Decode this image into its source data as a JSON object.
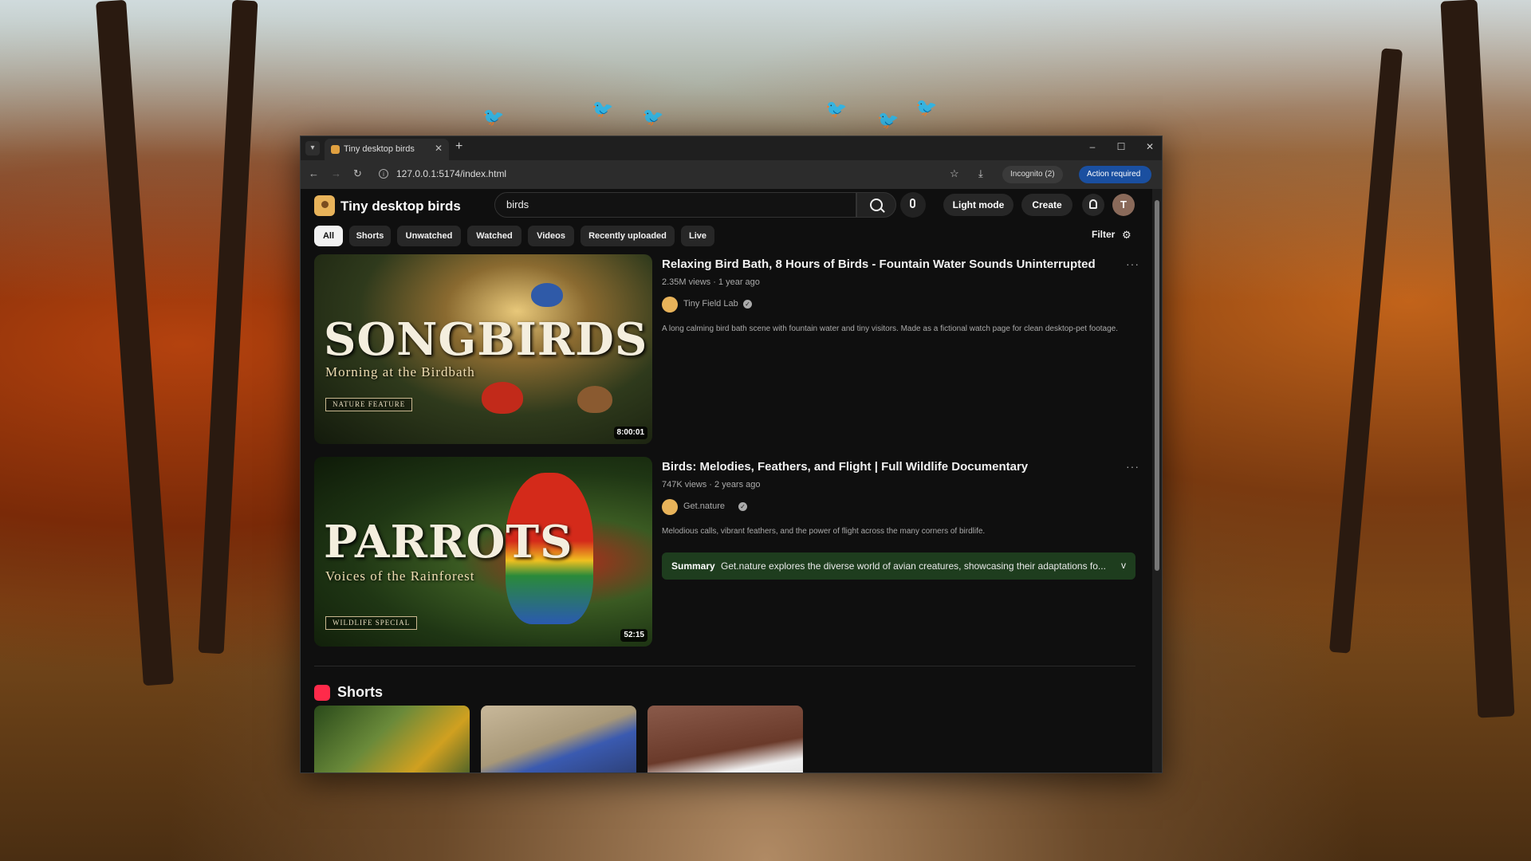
{
  "browser": {
    "tab_title": "Tiny desktop birds",
    "url": "127.0.0.1:5174/index.html",
    "incognito_label": "Incognito (2)",
    "action_label": "Action required"
  },
  "header": {
    "site_title": "Tiny desktop birds",
    "search_value": "birds",
    "light_mode_label": "Light mode",
    "create_label": "Create",
    "avatar_initial": "T"
  },
  "chips": [
    {
      "label": "All",
      "active": true
    },
    {
      "label": "Shorts"
    },
    {
      "label": "Unwatched"
    },
    {
      "label": "Watched"
    },
    {
      "label": "Videos"
    },
    {
      "label": "Recently uploaded"
    },
    {
      "label": "Live"
    }
  ],
  "filter_label": "Filter",
  "results": [
    {
      "title": "Relaxing Bird Bath, 8 Hours of Birds - Fountain Water Sounds Uninterrupted",
      "meta": "2.35M views · 1 year ago",
      "channel": "Tiny Field Lab",
      "description": "A long calming bird bath scene with fountain water and tiny visitors. Made as a fictional watch page for clean desktop-pet footage.",
      "duration": "8:00:01",
      "thumb_title": "SONGBIRDS",
      "thumb_subtitle": "Morning at the Birdbath",
      "thumb_tag": "NATURE FEATURE"
    },
    {
      "title": "Birds: Melodies, Feathers, and Flight | Full Wildlife Documentary",
      "meta": "747K views · 2 years ago",
      "channel": "Get.nature",
      "description": "Melodious calls, vibrant feathers, and the power of flight across the many corners of birdlife.",
      "duration": "52:15",
      "thumb_title": "PARROTS",
      "thumb_subtitle": "Voices of the Rainforest",
      "thumb_tag": "WILDLIFE SPECIAL",
      "summary_label": "Summary",
      "summary_text": "Get.nature explores the diverse world of avian creatures, showcasing their adaptations fo..."
    }
  ],
  "shorts": {
    "title": "Shorts"
  },
  "icons": [
    "search-icon",
    "mic-icon",
    "bell-icon",
    "filter-icon",
    "star-icon",
    "download-icon",
    "back-icon",
    "forward-icon",
    "reload-icon"
  ],
  "colors": {
    "page_bg": "#0f0f0f",
    "summary_bg": "#1e3d1e",
    "shorts_accent": "#ff2a4a",
    "action_bg": "#1a4fa0"
  }
}
